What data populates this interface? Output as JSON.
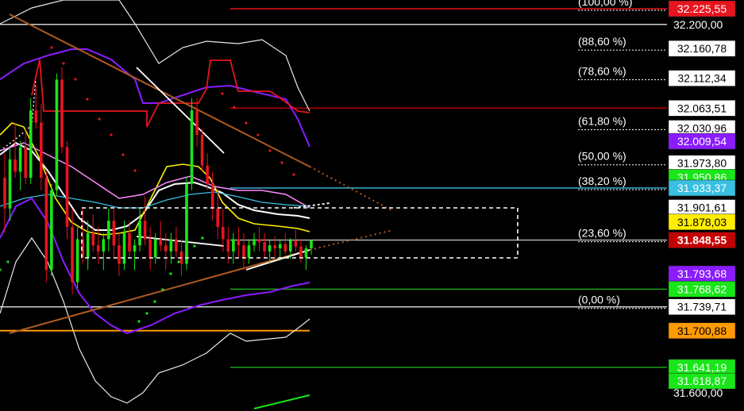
{
  "chart_data": {
    "type": "candlestick",
    "y_axis_labels": [
      "32.200,00",
      "31.600,00"
    ],
    "fibonacci_levels": [
      {
        "label": "(100,00 %)",
        "value": 32225.55
      },
      {
        "label": "(88,60 %)",
        "value": 32160.78
      },
      {
        "label": "(78,60 %)",
        "value": 32112.34
      },
      {
        "label": "(61,80 %)",
        "value": 32030.96
      },
      {
        "label": "(50,00 %)",
        "value": 31973.8
      },
      {
        "label": "(38,20 %)",
        "value": 31933.37
      },
      {
        "label": "(23,60 %)",
        "value": 31848.55
      },
      {
        "label": "(0,00 %)",
        "value": 31739.71
      }
    ],
    "price_tags": [
      {
        "text": "32.225,55",
        "value": 32225.55,
        "bg": "#e8141e",
        "fg": "#ffffff"
      },
      {
        "text": "32.160,78",
        "value": 32160.78,
        "bg": "#ffffff",
        "fg": "#000000"
      },
      {
        "text": "32.112,34",
        "value": 32112.34,
        "bg": "#ffffff",
        "fg": "#000000"
      },
      {
        "text": "32.063,51",
        "value": 32063.51,
        "bg": "#ffffff",
        "fg": "#000000"
      },
      {
        "text": "32.030,96",
        "value": 32030.96,
        "bg": "#ffffff",
        "fg": "#000000"
      },
      {
        "text": "32.009,54",
        "value": 32009.54,
        "bg": "#8a1cff",
        "fg": "#ffffff"
      },
      {
        "text": "31.973,80",
        "value": 31973.8,
        "bg": "#ffffff",
        "fg": "#000000"
      },
      {
        "text": "31.950,86",
        "value": 31950.86,
        "bg": "#19e619",
        "fg": "#ffffff"
      },
      {
        "text": "31.933,37",
        "value": 31933.37,
        "bg": "#39c0e0",
        "fg": "#ffffff"
      },
      {
        "text": "31.901,61",
        "value": 31901.61,
        "bg": "#ffffff",
        "fg": "#000000"
      },
      {
        "text": "31.878,03",
        "value": 31878.03,
        "bg": "#ffee00",
        "fg": "#000000"
      },
      {
        "text": "31.848,55",
        "value": 31848.55,
        "bg": "#c40000",
        "fg": "#ffffff"
      },
      {
        "text": "31.793,68",
        "value": 31793.68,
        "bg": "#8a1cff",
        "fg": "#ffffff"
      },
      {
        "text": "31.768,62",
        "value": 31768.62,
        "bg": "#19e619",
        "fg": "#ffffff"
      },
      {
        "text": "31.739,71",
        "value": 31739.71,
        "bg": "#ffffff",
        "fg": "#000000"
      },
      {
        "text": "31.700,88",
        "value": 31700.88,
        "bg": "#ff9a00",
        "fg": "#000000"
      },
      {
        "text": "31.641,19",
        "value": 31641.19,
        "bg": "#19e619",
        "fg": "#ffffff"
      },
      {
        "text": "31.618,87",
        "value": 31618.87,
        "bg": "#19e619",
        "fg": "#ffffff"
      }
    ],
    "horizontal_levels": [
      {
        "value": 32225.55,
        "color": "#e8141e"
      },
      {
        "value": 32200.0,
        "color": "#d0d0d0"
      },
      {
        "value": 32063.51,
        "color": "#c40000"
      },
      {
        "value": 31933.37,
        "color": "#39c0e0"
      },
      {
        "value": 31848.55,
        "color": "#bbbbbb"
      },
      {
        "value": 31768.62,
        "color": "#19b019"
      },
      {
        "value": 31739.71,
        "color": "#d0d0d0"
      },
      {
        "value": 31700.88,
        "color": "#ff9a00"
      },
      {
        "value": 31641.19,
        "color": "#19b019"
      }
    ],
    "candles": [
      [
        31950,
        31990,
        31860,
        31900
      ],
      [
        31900,
        32000,
        31880,
        31980
      ],
      [
        31980,
        32040,
        31950,
        31960
      ],
      [
        31960,
        32010,
        31930,
        32000
      ],
      [
        32000,
        32030,
        31940,
        31950
      ],
      [
        31950,
        32080,
        31940,
        32060
      ],
      [
        32060,
        32100,
        32030,
        32040
      ],
      [
        32040,
        32070,
        31930,
        31950
      ],
      [
        31950,
        31960,
        31780,
        31800
      ],
      [
        31800,
        31940,
        31790,
        31930
      ],
      [
        31930,
        32120,
        31920,
        32110
      ],
      [
        32110,
        32130,
        31990,
        32000
      ],
      [
        32000,
        32010,
        31850,
        31870
      ],
      [
        31870,
        31900,
        31760,
        31780
      ],
      [
        31780,
        31870,
        31770,
        31850
      ],
      [
        31850,
        31900,
        31810,
        31820
      ],
      [
        31820,
        31880,
        31800,
        31860
      ],
      [
        31860,
        31890,
        31830,
        31840
      ],
      [
        31840,
        31870,
        31810,
        31830
      ],
      [
        31830,
        31860,
        31800,
        31850
      ],
      [
        31850,
        31900,
        31830,
        31880
      ],
      [
        31880,
        31900,
        31820,
        31840
      ],
      [
        31840,
        31860,
        31790,
        31810
      ],
      [
        31810,
        31880,
        31800,
        31860
      ],
      [
        31860,
        31880,
        31820,
        31830
      ],
      [
        31830,
        31850,
        31800,
        31840
      ],
      [
        31840,
        31900,
        31830,
        31880
      ],
      [
        31880,
        31920,
        31840,
        31850
      ],
      [
        31850,
        31870,
        31800,
        31820
      ],
      [
        31820,
        31860,
        31810,
        31850
      ],
      [
        31850,
        31880,
        31830,
        31840
      ],
      [
        31840,
        31860,
        31800,
        31830
      ],
      [
        31830,
        31860,
        31810,
        31850
      ],
      [
        31850,
        31870,
        31820,
        31830
      ],
      [
        31830,
        31850,
        31790,
        31810
      ],
      [
        31810,
        31950,
        31800,
        31940
      ],
      [
        31940,
        32080,
        31930,
        32060
      ],
      [
        32060,
        32080,
        32000,
        32020
      ],
      [
        32020,
        32030,
        31960,
        31970
      ],
      [
        31970,
        31990,
        31930,
        31940
      ],
      [
        31940,
        31960,
        31880,
        31900
      ],
      [
        31900,
        31930,
        31850,
        31870
      ],
      [
        31870,
        31900,
        31830,
        31850
      ],
      [
        31850,
        31870,
        31810,
        31830
      ],
      [
        31830,
        31860,
        31810,
        31850
      ],
      [
        31850,
        31870,
        31820,
        31840
      ],
      [
        31840,
        31860,
        31800,
        31820
      ],
      [
        31820,
        31850,
        31810,
        31840
      ],
      [
        31840,
        31860,
        31830,
        31850
      ],
      [
        31850,
        31870,
        31830,
        31845
      ],
      [
        31845,
        31860,
        31820,
        31830
      ],
      [
        31830,
        31850,
        31810,
        31840
      ],
      [
        31840,
        31855,
        31820,
        31835
      ],
      [
        31835,
        31850,
        31815,
        31842
      ],
      [
        31842,
        31860,
        31825,
        31830
      ],
      [
        31830,
        31852,
        31818,
        31848
      ],
      [
        31848,
        31865,
        31830,
        31838
      ],
      [
        31838,
        31850,
        31812,
        31820
      ],
      [
        31820,
        31840,
        31800,
        31835
      ],
      [
        31835,
        31849,
        31825,
        31848
      ]
    ]
  }
}
